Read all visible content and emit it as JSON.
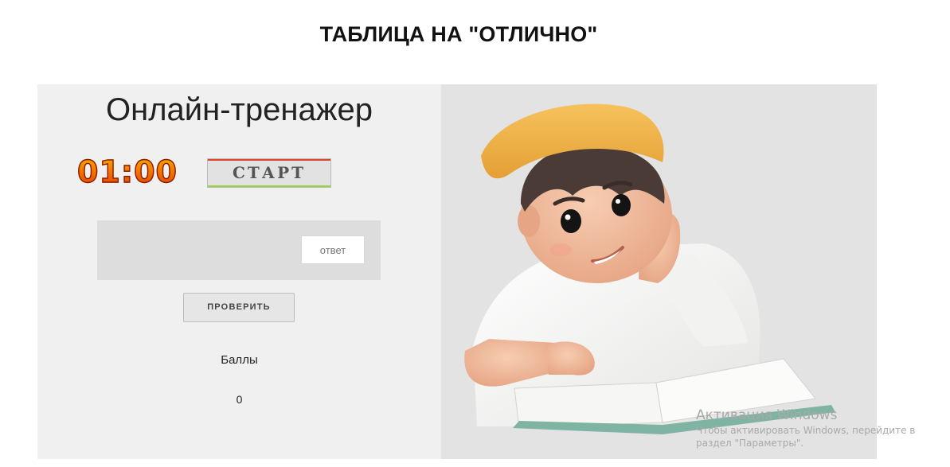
{
  "page": {
    "title": "ТАБЛИЦА НА \"ОТЛИЧНО\""
  },
  "trainer": {
    "title": "Онлайн-тренажер",
    "timer": "01:00",
    "start_label": "СТАРТ",
    "answer_placeholder": "ответ",
    "check_label": "ПРОВЕРИТЬ",
    "score_label": "Баллы",
    "score_value": "0"
  },
  "illustration": {
    "icon": "boy-reading-book-illustration"
  },
  "watermark": {
    "title": "Активация Windows",
    "line1": "Чтобы активировать Windows, перейдите в",
    "line2": "раздел \"Параметры\"."
  },
  "colors": {
    "left_panel": "#f0f0f0",
    "right_panel": "#e3e3e3",
    "timer_top": "#f8b400",
    "timer_bottom": "#e23a00",
    "cap": "#f0b24a",
    "shirt": "#f4f4f2"
  }
}
